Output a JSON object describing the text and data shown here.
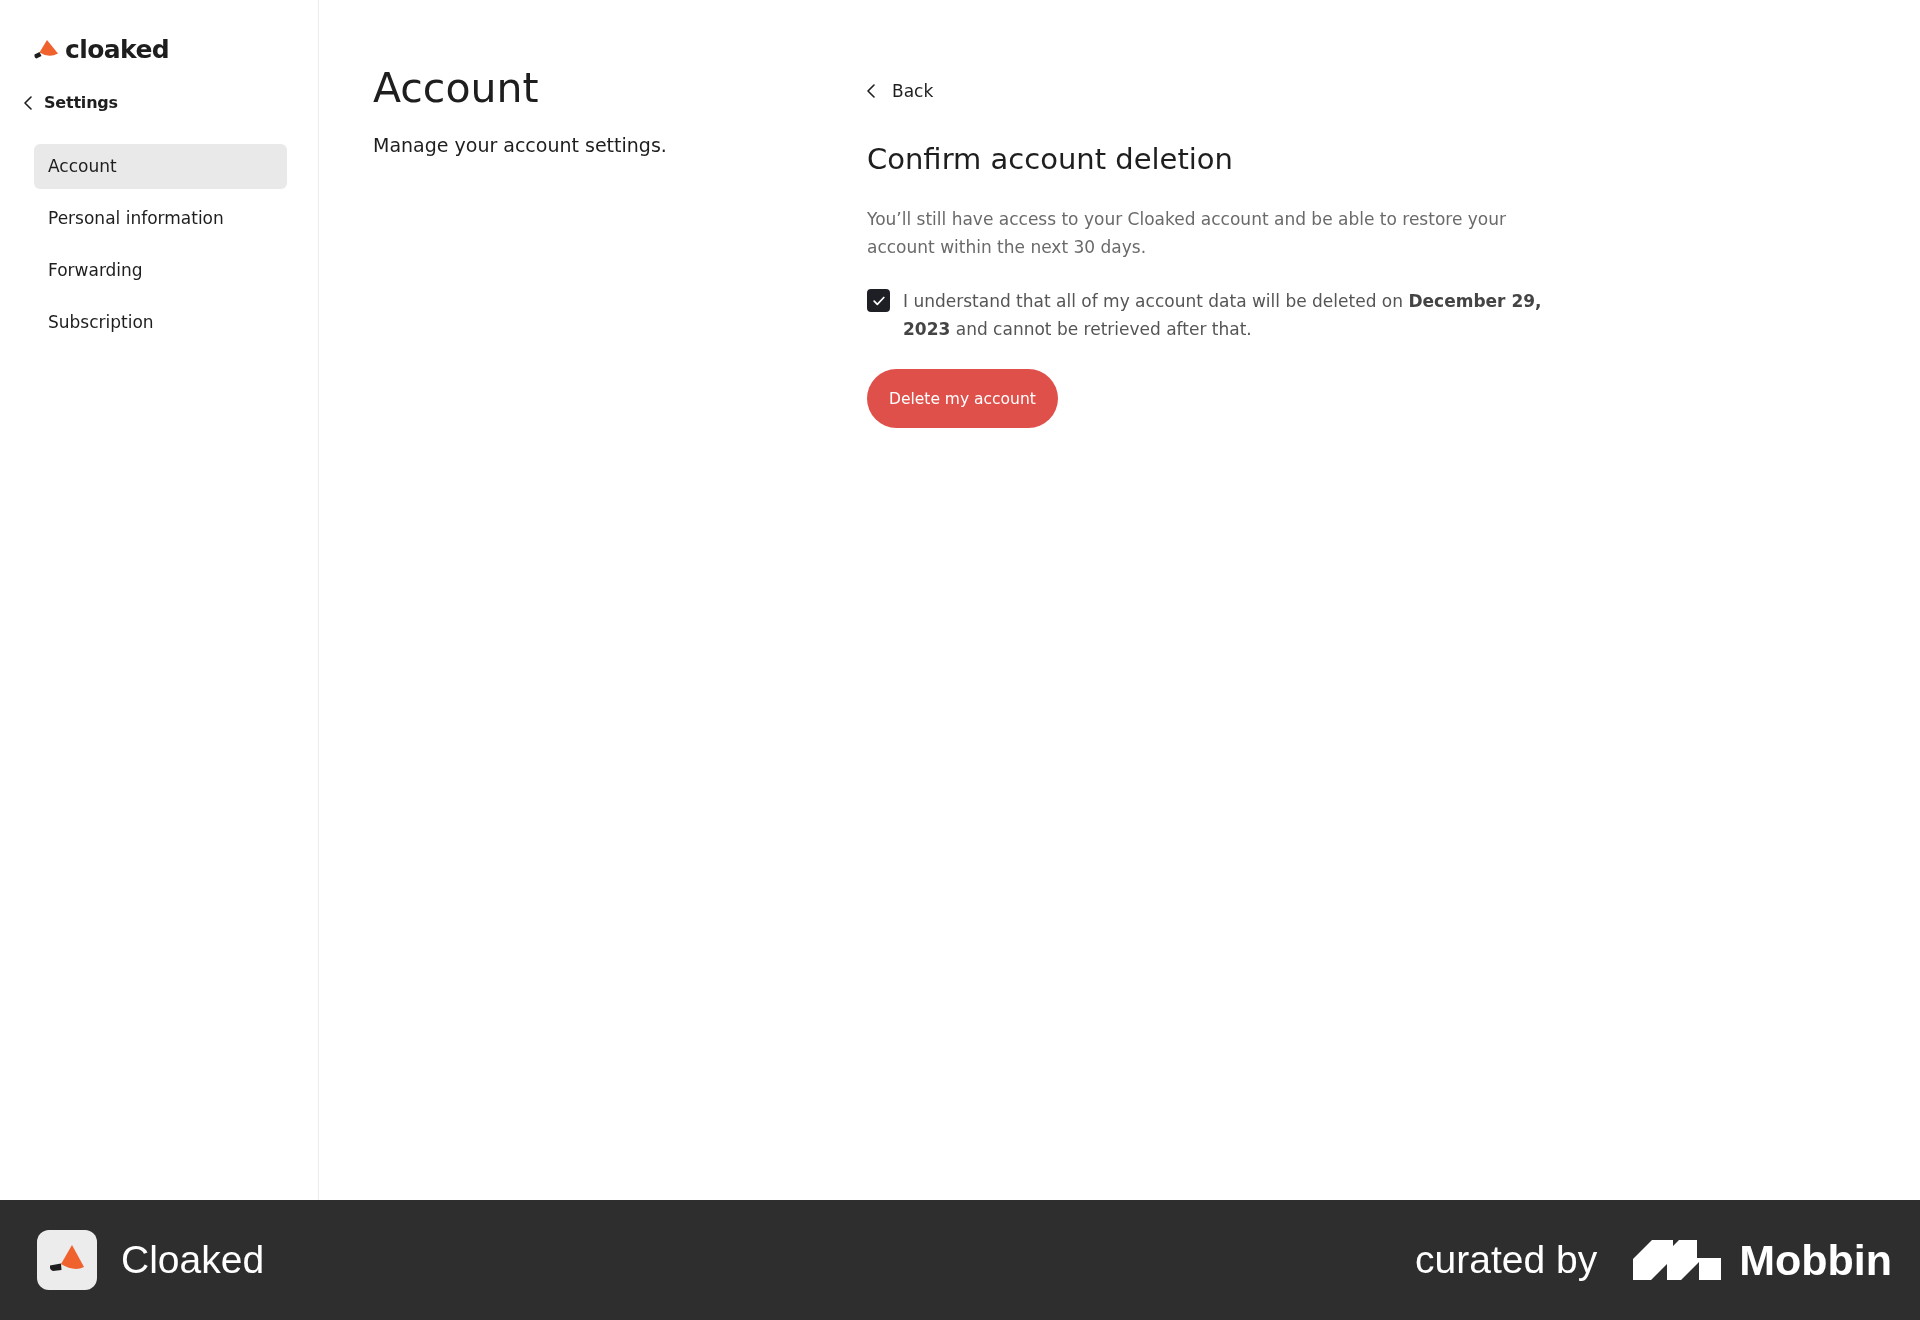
{
  "sidebar": {
    "logo": {
      "text": "cloaked"
    },
    "back_link": {
      "label": "Settings"
    },
    "items": [
      {
        "label": "Account",
        "selected": true
      },
      {
        "label": "Personal information",
        "selected": false
      },
      {
        "label": "Forwarding",
        "selected": false
      },
      {
        "label": "Subscription",
        "selected": false
      }
    ]
  },
  "header": {
    "title": "Account",
    "subtitle": "Manage your account settings."
  },
  "panel": {
    "back_link": {
      "label": "Back"
    },
    "title": "Confirm account deletion",
    "description": "You’ll still have access to your Cloaked account and be able to restore your account within the next 30 days.",
    "consent": {
      "text": "I understand that all of my account data will be deleted on **December 29, 2023** and cannot be retrieved after that.",
      "checked": true
    },
    "button": {
      "label": "Delete my account"
    }
  },
  "footer": {
    "app_name": "Cloaked",
    "curated_by": "curated by",
    "brand": "Mobbin"
  }
}
